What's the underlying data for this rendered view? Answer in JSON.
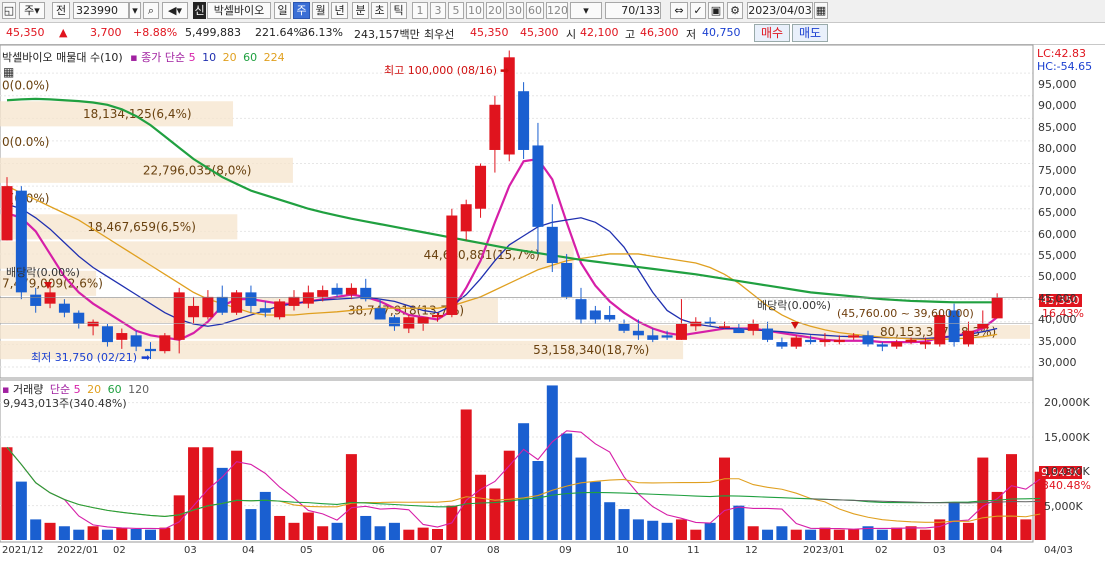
{
  "toolbar": {
    "mode": "주",
    "jeon_label": "전",
    "code": "323990",
    "stock_badge": "신",
    "stock_name": "박셀바이오",
    "periods": [
      "일",
      "주",
      "월",
      "년",
      "분",
      "초",
      "틱"
    ],
    "active_period": "주",
    "counts": [
      "1",
      "3",
      "5",
      "10",
      "20",
      "30",
      "60",
      "120"
    ],
    "page_counter": "70",
    "page_total": "/133",
    "date": "2023/04/03"
  },
  "quote": {
    "price": "45,350",
    "arrow": "▲",
    "change": "3,700",
    "change_pct": "+8.88%",
    "volume": "5,499,883",
    "volume_ratio": "221.64%",
    "turnover": "36.13%",
    "amount": "243,157백만",
    "priority_label": "최우선",
    "bid": "45,350",
    "ask": "45,300",
    "open_label": "시",
    "open": "42,100",
    "high_label": "고",
    "high": "46,300",
    "low_label": "저",
    "low": "40,750",
    "buy_button": "매수",
    "sell_button": "매도"
  },
  "price_panel": {
    "title": "박셀바이오 매물대 수(10)",
    "ma_label": "종가 단순",
    "ma_periods": [
      "5",
      "10",
      "20",
      "60",
      "224"
    ],
    "corner_lc": "LC:42.83",
    "corner_hc": "HC:-54.65",
    "last_price_tag": "45,350",
    "last_pct_tag": "16.43%",
    "high_annotation": "최고 100,000 (08/16)",
    "low_annotation": "최저 31,750 (02/21)",
    "dividend_labels": [
      "배당락(0.00%)",
      "배당락(0.00%)"
    ],
    "range_label": "(45,760.00 ~ 39,600.00)",
    "y_ticks": [
      "95,000",
      "90,000",
      "85,000",
      "80,000",
      "75,000",
      "70,000",
      "65,000",
      "60,000",
      "55,000",
      "50,000",
      "45,000",
      "40,000",
      "35,000",
      "30,000"
    ]
  },
  "volume_panel": {
    "title": "거래량",
    "ma_label": "단순",
    "ma_periods": [
      "5",
      "20",
      "60",
      "120"
    ],
    "last_volume": "9,943,013주(340.48%)",
    "last_tag": "9,943K",
    "last_pct_tag": "340.48%",
    "y_ticks": [
      "20,000K",
      "15,000K",
      "10,000K",
      "5,000K"
    ]
  },
  "x_labels": [
    "2021/12",
    "2022/01",
    "02",
    "03",
    "04",
    "05",
    "06",
    "07",
    "08",
    "09",
    "10",
    "11",
    "12",
    "2023/01",
    "02",
    "03",
    "04",
    "04/03"
  ],
  "chart_data": {
    "type": "candlestick",
    "title": "박셀바이오 매물대 수(10)",
    "period": "weekly",
    "y_range": [
      28000,
      101000
    ],
    "volume_range": [
      0,
      23000000
    ],
    "volume_profile": [
      {
        "label": "0(0.0%)",
        "price_low": 89000,
        "price_high": 95500,
        "shares": 0
      },
      {
        "label": "18,134,125(6,4%)",
        "price_low": 83000,
        "price_high": 89000,
        "shares": 18134125
      },
      {
        "label": "0(0.0%)",
        "price_low": 76500,
        "price_high": 83000,
        "shares": 0
      },
      {
        "label": "22,796,035(8,0%)",
        "price_low": 70500,
        "price_high": 76500,
        "shares": 22796035
      },
      {
        "label": "0(0.0%)",
        "price_low": 64000,
        "price_high": 70500,
        "shares": 0
      },
      {
        "label": "18,467,659(6,5%)",
        "price_low": 58000,
        "price_high": 64000,
        "shares": 18467659
      },
      {
        "label": "44,640,881(15,7%)",
        "price_low": 51500,
        "price_high": 58000,
        "shares": 44640881
      },
      {
        "label": "7,479,009(2,6%)",
        "price_low": 45500,
        "price_high": 51500,
        "shares": 7479009
      },
      {
        "label": "38,747,918(13,7%)",
        "price_low": 39500,
        "price_high": 45500,
        "shares": 38747918
      },
      {
        "label": "80,153,367(28,3%)",
        "price_low": 36000,
        "price_high": 39500,
        "shares": 80153367
      },
      {
        "label": "53,158,340(18,7%)",
        "price_low": 31500,
        "price_high": 36000,
        "shares": 53158340
      }
    ],
    "candles": [
      {
        "o": 58000,
        "h": 72000,
        "l": 58000,
        "c": 70000
      },
      {
        "o": 69000,
        "h": 70000,
        "l": 45000,
        "c": 46500
      },
      {
        "o": 46000,
        "h": 47500,
        "l": 42000,
        "c": 43500
      },
      {
        "o": 44000,
        "h": 48500,
        "l": 43000,
        "c": 46500
      },
      {
        "o": 44000,
        "h": 45000,
        "l": 41000,
        "c": 42000
      },
      {
        "o": 42000,
        "h": 42500,
        "l": 38500,
        "c": 39500
      },
      {
        "o": 39000,
        "h": 40500,
        "l": 37000,
        "c": 40000
      },
      {
        "o": 39000,
        "h": 39500,
        "l": 34500,
        "c": 35500
      },
      {
        "o": 36000,
        "h": 38500,
        "l": 34000,
        "c": 37500
      },
      {
        "o": 37000,
        "h": 38000,
        "l": 33500,
        "c": 34500
      },
      {
        "o": 34000,
        "h": 35500,
        "l": 31750,
        "c": 33500
      },
      {
        "o": 33500,
        "h": 37500,
        "l": 33000,
        "c": 37000
      },
      {
        "o": 36000,
        "h": 47500,
        "l": 33000,
        "c": 46500
      },
      {
        "o": 41000,
        "h": 45500,
        "l": 39500,
        "c": 43500
      },
      {
        "o": 41000,
        "h": 47000,
        "l": 40500,
        "c": 45500
      },
      {
        "o": 45500,
        "h": 48000,
        "l": 41500,
        "c": 42000
      },
      {
        "o": 42000,
        "h": 47000,
        "l": 41500,
        "c": 46500
      },
      {
        "o": 46500,
        "h": 48000,
        "l": 42000,
        "c": 43500
      },
      {
        "o": 43000,
        "h": 44500,
        "l": 41000,
        "c": 42000
      },
      {
        "o": 41000,
        "h": 45000,
        "l": 40500,
        "c": 44500
      },
      {
        "o": 43500,
        "h": 47000,
        "l": 42500,
        "c": 45500
      },
      {
        "o": 44000,
        "h": 48000,
        "l": 43000,
        "c": 46500
      },
      {
        "o": 45500,
        "h": 48000,
        "l": 44500,
        "c": 47000
      },
      {
        "o": 47500,
        "h": 48500,
        "l": 45500,
        "c": 46000
      },
      {
        "o": 46000,
        "h": 48500,
        "l": 45000,
        "c": 47500
      },
      {
        "o": 47500,
        "h": 49500,
        "l": 44500,
        "c": 45000
      },
      {
        "o": 43000,
        "h": 45000,
        "l": 40500,
        "c": 40500
      },
      {
        "o": 41000,
        "h": 41500,
        "l": 38000,
        "c": 39000
      },
      {
        "o": 38500,
        "h": 41500,
        "l": 37500,
        "c": 41000
      },
      {
        "o": 39500,
        "h": 41000,
        "l": 38000,
        "c": 41000
      },
      {
        "o": 41000,
        "h": 42000,
        "l": 40000,
        "c": 41500
      },
      {
        "o": 41500,
        "h": 65000,
        "l": 41000,
        "c": 63500
      },
      {
        "o": 60000,
        "h": 67000,
        "l": 58000,
        "c": 66000
      },
      {
        "o": 65000,
        "h": 75000,
        "l": 63000,
        "c": 74500
      },
      {
        "o": 78000,
        "h": 90000,
        "l": 73000,
        "c": 88000
      },
      {
        "o": 77000,
        "h": 100000,
        "l": 75500,
        "c": 98500
      },
      {
        "o": 91000,
        "h": 93000,
        "l": 76000,
        "c": 78000
      },
      {
        "o": 79000,
        "h": 84000,
        "l": 55000,
        "c": 61000
      },
      {
        "o": 61000,
        "h": 66000,
        "l": 51000,
        "c": 53000
      },
      {
        "o": 53000,
        "h": 55000,
        "l": 45000,
        "c": 45500
      },
      {
        "o": 45000,
        "h": 47500,
        "l": 39500,
        "c": 40500
      },
      {
        "o": 42500,
        "h": 43500,
        "l": 39500,
        "c": 40500
      },
      {
        "o": 41500,
        "h": 43500,
        "l": 40000,
        "c": 40500
      },
      {
        "o": 39500,
        "h": 40500,
        "l": 37500,
        "c": 38000
      },
      {
        "o": 38000,
        "h": 40500,
        "l": 36000,
        "c": 37000
      },
      {
        "o": 37000,
        "h": 38500,
        "l": 35500,
        "c": 36000
      },
      {
        "o": 37000,
        "h": 38000,
        "l": 36000,
        "c": 36500
      },
      {
        "o": 36000,
        "h": 45000,
        "l": 36000,
        "c": 39500
      },
      {
        "o": 39000,
        "h": 41000,
        "l": 38000,
        "c": 40000
      },
      {
        "o": 40000,
        "h": 41000,
        "l": 39000,
        "c": 39500
      },
      {
        "o": 39000,
        "h": 40000,
        "l": 38500,
        "c": 39000
      },
      {
        "o": 38500,
        "h": 39500,
        "l": 37500,
        "c": 37500
      },
      {
        "o": 38000,
        "h": 40500,
        "l": 37000,
        "c": 39500
      },
      {
        "o": 38500,
        "h": 40000,
        "l": 35500,
        "c": 36000
      },
      {
        "o": 35500,
        "h": 36500,
        "l": 34000,
        "c": 34500
      },
      {
        "o": 34500,
        "h": 37000,
        "l": 34000,
        "c": 36500
      },
      {
        "o": 36000,
        "h": 37000,
        "l": 35000,
        "c": 35500
      },
      {
        "o": 35500,
        "h": 37500,
        "l": 34500,
        "c": 36000
      },
      {
        "o": 35500,
        "h": 37000,
        "l": 35000,
        "c": 36000
      },
      {
        "o": 36500,
        "h": 37500,
        "l": 36000,
        "c": 37000
      },
      {
        "o": 37000,
        "h": 38000,
        "l": 34500,
        "c": 35000
      },
      {
        "o": 35000,
        "h": 35500,
        "l": 33500,
        "c": 34500
      },
      {
        "o": 34500,
        "h": 36000,
        "l": 34000,
        "c": 35500
      },
      {
        "o": 35500,
        "h": 36500,
        "l": 35000,
        "c": 36000
      },
      {
        "o": 35000,
        "h": 36500,
        "l": 34000,
        "c": 35500
      },
      {
        "o": 35000,
        "h": 42500,
        "l": 34500,
        "c": 41500
      },
      {
        "o": 42500,
        "h": 44000,
        "l": 34500,
        "c": 35500
      },
      {
        "o": 35000,
        "h": 40000,
        "l": 34500,
        "c": 38000
      },
      {
        "o": 38500,
        "h": 42500,
        "l": 38500,
        "c": 39500
      },
      {
        "o": 40750,
        "h": 46300,
        "l": 40750,
        "c": 45350
      }
    ],
    "ma": [
      {
        "name": "5",
        "color": "#d61fa8",
        "values": [
          64000,
          63000,
          60000,
          55000,
          50000,
          46500,
          44000,
          42000,
          40000,
          38000,
          37000,
          36500,
          36000,
          37500,
          40000,
          43500,
          45000,
          45000,
          44500,
          44000,
          44000,
          44500,
          45000,
          45500,
          46000,
          45500,
          44500,
          43000,
          41500,
          41000,
          40500,
          42500,
          47500,
          53500,
          62000,
          70000,
          75500,
          76000,
          71500,
          62000,
          53000,
          48000,
          44500,
          42000,
          40000,
          38500,
          37500,
          37000,
          37500,
          38000,
          38500,
          38500,
          38500,
          38000,
          37500,
          37000,
          36500,
          36000,
          35800,
          35800,
          35800,
          35500,
          35500,
          35500,
          35600,
          36500,
          36800,
          37500,
          38500,
          41000
        ]
      },
      {
        "name": "10",
        "color": "#2030b0",
        "values": [
          66000,
          65000,
          63000,
          60500,
          57500,
          54500,
          52000,
          50000,
          48000,
          46000,
          44000,
          42000,
          40500,
          39500,
          39000,
          39500,
          40500,
          41500,
          42500,
          43500,
          44000,
          44500,
          44800,
          45000,
          45200,
          45500,
          45000,
          44500,
          43500,
          42500,
          42000,
          43500,
          46000,
          49500,
          53500,
          57000,
          59000,
          61000,
          62000,
          62500,
          63000,
          62000,
          60000,
          56500,
          51500,
          46500,
          42500,
          40500,
          39500,
          39000,
          38500,
          38500,
          38200,
          38000,
          37800,
          37500,
          37200,
          37000,
          36800,
          36700,
          36600,
          36500,
          36400,
          36300,
          36300,
          36500,
          36800,
          37200,
          37800,
          38500
        ]
      },
      {
        "name": "20",
        "color": "#e0a020",
        "values": [
          70000,
          68500,
          67000,
          65500,
          64000,
          62500,
          60500,
          58500,
          56500,
          54500,
          52500,
          50500,
          48500,
          46500,
          45000,
          44000,
          43000,
          42000,
          41500,
          41500,
          41500,
          41800,
          42000,
          42200,
          42500,
          42800,
          43000,
          43000,
          43000,
          43000,
          43000,
          43500,
          44500,
          45500,
          47000,
          48500,
          50000,
          51500,
          52500,
          53500,
          54000,
          54500,
          55000,
          55000,
          55000,
          54500,
          54000,
          53500,
          53000,
          52000,
          50500,
          48500,
          46000,
          43500,
          41500,
          40000,
          39000,
          38200,
          37600,
          37200,
          36900,
          36600,
          36400,
          36200,
          36100,
          36100,
          36200,
          36400,
          36700,
          37200
        ]
      },
      {
        "name": "60",
        "color": "#20a040",
        "values": [
          89000,
          89200,
          89300,
          89200,
          89000,
          88800,
          88500,
          88000,
          87000,
          85500,
          83500,
          81000,
          78500,
          76000,
          74000,
          72000,
          70500,
          69000,
          68000,
          67000,
          66000,
          65000,
          64200,
          63500,
          62800,
          62200,
          61600,
          61000,
          60400,
          59800,
          59200,
          58600,
          58000,
          57400,
          56800,
          56200,
          55700,
          55200,
          54700,
          54200,
          53700,
          53300,
          52900,
          52500,
          52100,
          51700,
          51300,
          50900,
          50500,
          50000,
          49500,
          49000,
          48500,
          48000,
          47500,
          47000,
          46500,
          46200,
          45900,
          45600,
          45300,
          45000,
          44800,
          44600,
          44500,
          44400,
          44300,
          44300,
          44300,
          44300
        ]
      }
    ],
    "volume": {
      "values": [
        13500000,
        8500000,
        3000000,
        2500000,
        2000000,
        1500000,
        2000000,
        1500000,
        1800000,
        1600000,
        1500000,
        1800000,
        6500000,
        13500000,
        13500000,
        10500000,
        13000000,
        4500000,
        7000000,
        3500000,
        2500000,
        4000000,
        2000000,
        2500000,
        12500000,
        3500000,
        2000000,
        2500000,
        1500000,
        1800000,
        1600000,
        5000000,
        19000000,
        9500000,
        7500000,
        13000000,
        17000000,
        11500000,
        22500000,
        15500000,
        12000000,
        8500000,
        5500000,
        4500000,
        3000000,
        2800000,
        2500000,
        3000000,
        1500000,
        2500000,
        12000000,
        5000000,
        2000000,
        1500000,
        2000000,
        1500000,
        1500000,
        1800000,
        1500000,
        1600000,
        2000000,
        1500000,
        1800000,
        2000000,
        1500000,
        3000000,
        5500000,
        2500000,
        12000000,
        7000000,
        12500000,
        3000000,
        9943013
      ],
      "ma5_color": "#d61fa8",
      "ma20_color": "#e0a020",
      "ma60_color": "#20a040",
      "ma120_color": "#606060"
    },
    "up_color": "#e0141e",
    "down_color": "#1a5fd0"
  }
}
